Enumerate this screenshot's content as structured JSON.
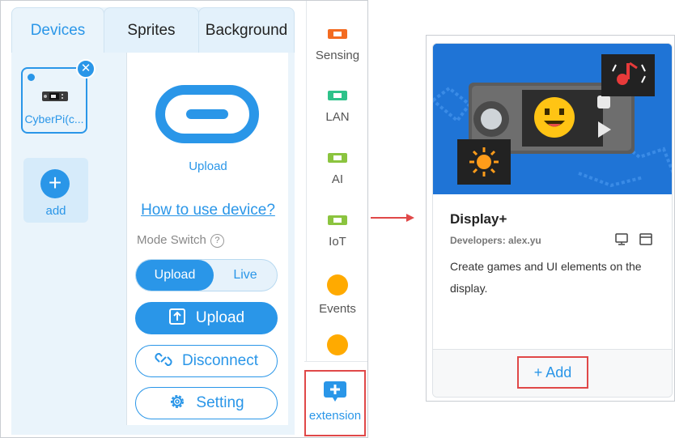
{
  "tabs": [
    {
      "label": "Devices",
      "active": true
    },
    {
      "label": "Sprites",
      "active": false
    },
    {
      "label": "Background",
      "active": false
    }
  ],
  "device_list": {
    "device_name": "CyberPi(c...",
    "add_label": "add"
  },
  "device_detail": {
    "upload_caption": "Upload",
    "how_to_link": "How to use device?",
    "mode_switch_label": "Mode Switch",
    "mode_help_icon": "?",
    "mode_options": {
      "upload": "Upload",
      "live": "Live",
      "selected": "Upload"
    },
    "upload_button": "Upload",
    "disconnect_button": "Disconnect",
    "setting_button": "Setting"
  },
  "categories": [
    {
      "label": "Sensing",
      "icon": "board-icon",
      "color": "#f36b21"
    },
    {
      "label": "LAN",
      "icon": "board-icon",
      "color": "#2ec28a"
    },
    {
      "label": "AI",
      "icon": "board-icon",
      "color": "#8bc43f"
    },
    {
      "label": "IoT",
      "icon": "board-icon",
      "color": "#8bc43f"
    },
    {
      "label": "Events",
      "icon": "dot-icon",
      "color": "#ffaa00"
    },
    {
      "label": "",
      "icon": "dot-icon",
      "color": "#ffaa00"
    }
  ],
  "extension_button": {
    "label": "extension",
    "icon": "extension-add-icon"
  },
  "extension_card": {
    "title": "Display+",
    "developers": "Developers: alex.yu",
    "platforms": [
      "desktop-icon",
      "window-icon"
    ],
    "description": "Create games and UI elements on the display.",
    "add_label": "+ Add"
  },
  "colors": {
    "accent": "#2a96e8",
    "highlight_box": "#e04848",
    "banner": "#1f74d6"
  }
}
